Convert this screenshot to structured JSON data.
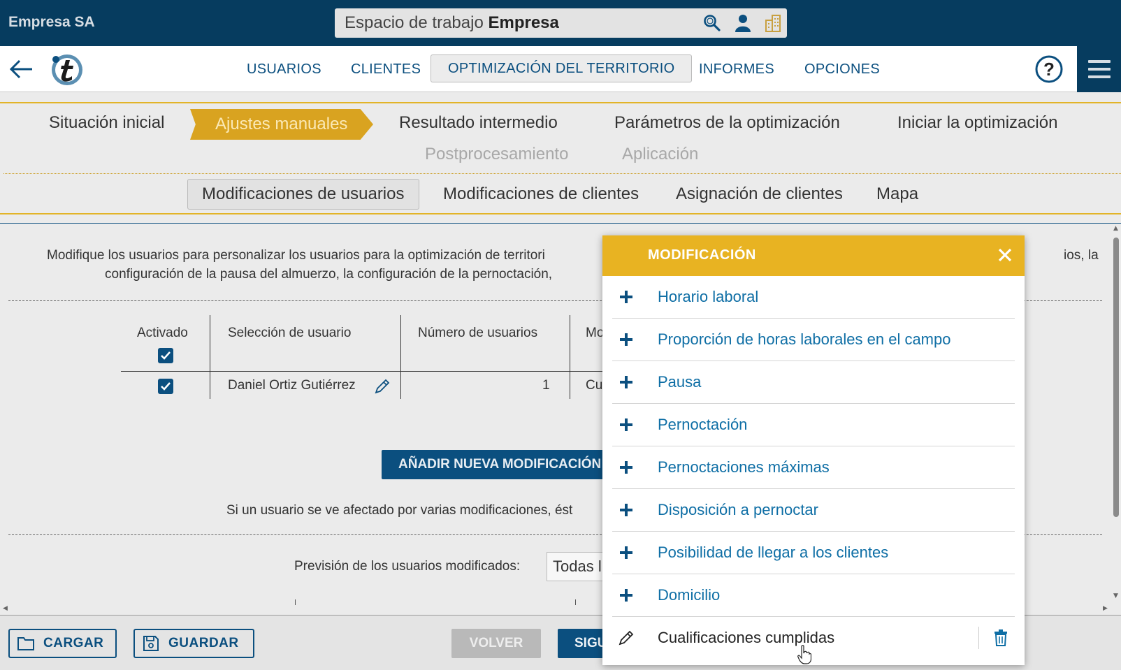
{
  "header": {
    "company": "Empresa SA",
    "workspace_prefix": "Espacio de trabajo",
    "workspace_name": "Empresa",
    "icons": [
      "search-icon",
      "user-icon",
      "building-icon"
    ]
  },
  "nav": {
    "items": [
      "USUARIOS",
      "CLIENTES",
      "OPTIMIZACIÓN DEL TERRITORIO",
      "INFORMES",
      "OPCIONES"
    ],
    "active": "OPTIMIZACIÓN DEL TERRITORIO"
  },
  "steps": {
    "row1": [
      "Situación inicial",
      "Ajustes manuales",
      "Resultado intermedio",
      "Parámetros de la optimización",
      "Iniciar la optimización"
    ],
    "row2": [
      "Postprocesamiento",
      "Aplicación"
    ],
    "active": "Ajustes manuales"
  },
  "subtabs": {
    "items": [
      "Modificaciones de usuarios",
      "Modificaciones de clientes",
      "Asignación de clientes",
      "Mapa"
    ],
    "active": "Modificaciones de usuarios"
  },
  "content": {
    "description_line1": "Modifique los usuarios para personalizar los usuarios para la optimización de territori",
    "description_line1_end": "ios, la",
    "description_line2": "configuración de la pausa del almuerzo, la configuración de la pernoctación,",
    "table": {
      "columns": [
        "Activado",
        "Selección de usuario",
        "Número de usuarios",
        "Mo"
      ],
      "rows": [
        {
          "active": true,
          "user": "Daniel Ortiz Gutiérrez",
          "count": "1",
          "mod": "Cu"
        }
      ]
    },
    "add_button": "AÑADIR NUEVA MODIFICACIÓN",
    "note": "Si un usuario se ve afectado por varias modificaciones, ést",
    "preview_label": "Previsión de los usuarios modificados:",
    "preview_value": "Todas l"
  },
  "bottom": {
    "load": "CARGAR",
    "save": "GUARDAR",
    "back": "VOLVER",
    "next": "SIGUIENTE"
  },
  "modal": {
    "title": "MODIFICACIÓN",
    "items": [
      "Horario laboral",
      "Proporción de horas laborales en el campo",
      "Pausa",
      "Pernoctación",
      "Pernoctaciones máximas",
      "Disposición a pernoctar",
      "Posibilidad de llegar a los clientes",
      "Domicilio"
    ],
    "edited_item": "Cualificaciones cumplidas"
  },
  "colors": {
    "primary": "#063c5f",
    "link": "#0e6ea5",
    "accent": "#e8b322"
  }
}
